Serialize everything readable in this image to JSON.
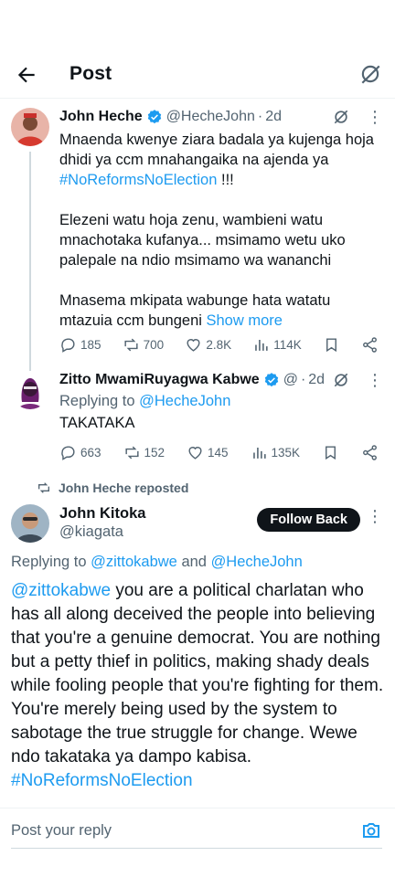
{
  "header": {
    "title": "Post"
  },
  "tweets": [
    {
      "name": "John Heche",
      "handle": "@HecheJohn",
      "time": "2d",
      "body_1": "Mnaenda kwenye ziara badala ya kujenga hoja dhidi ya ccm mnahangaika na ajenda ya ",
      "hashtag": "#NoReformsNoElection",
      "body_1_end": " !!!",
      "body_2": "Elezeni watu hoja zenu, wambieni watu mnachotaka kufanya... msimamo wetu uko palepale na ndio msimamo wa wananchi",
      "body_3": "Mnasema mkipata wabunge hata watatu mtazuia ccm bungeni ",
      "show_more": "Show more",
      "replies": "185",
      "reposts": "700",
      "likes": "2.8K",
      "views": "114K"
    },
    {
      "name": "Zitto MwamiRuyagwa Kabwe",
      "handle": "@",
      "time": "2d",
      "replying_prefix": "Replying to ",
      "replying_to": "@HecheJohn",
      "body": "TAKATAKA",
      "replies": "663",
      "reposts": "152",
      "likes": "145",
      "views": "135K"
    }
  ],
  "repost_label": "John Heche reposted",
  "main": {
    "name": "John Kitoka",
    "handle": "@kiagata",
    "follow_label": "Follow Back",
    "replying_prefix": "Replying to ",
    "replying_user_1": "@zittokabwe",
    "replying_and": " and ",
    "replying_user_2": "@HecheJohn",
    "mention": "@zittokabwe",
    "body": " you are a political charlatan who has all along deceived the people into believing that you're a genuine democrat. You are nothing but a petty thief in politics, making shady deals while fooling people that you're fighting for them. You're merely being used by the system to sabotage the true struggle for change. Wewe ndo takataka ya dampo kabisa.",
    "hashtag": "#NoReformsNoElection"
  },
  "reply_bar": {
    "placeholder": "Post your reply"
  },
  "colors": {
    "accent": "#1d9bf0",
    "text": "#0f1419",
    "muted": "#536471"
  }
}
